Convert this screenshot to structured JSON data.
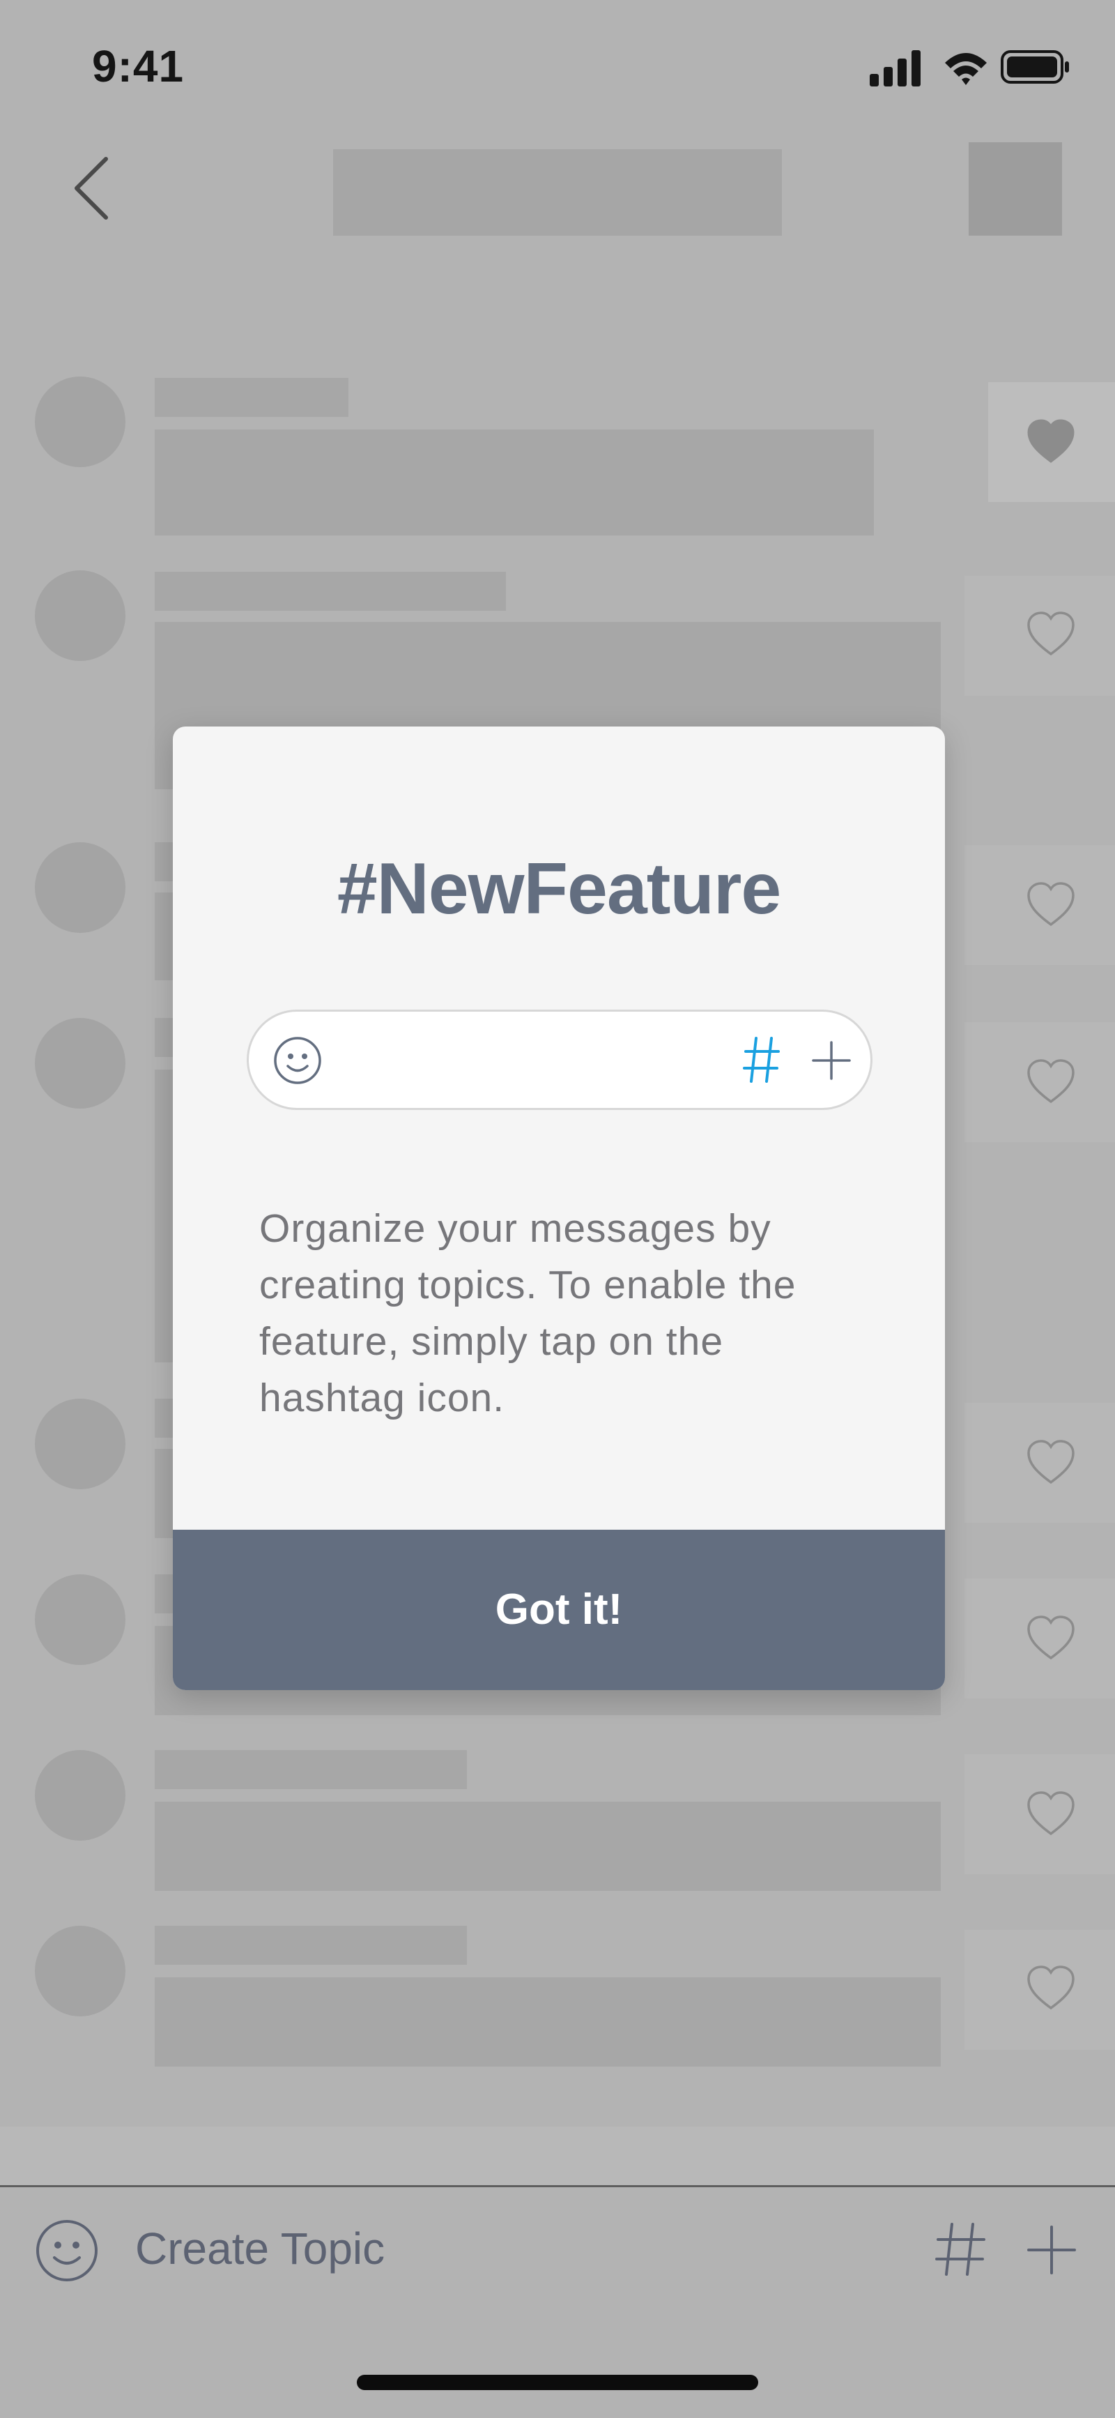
{
  "status_bar": {
    "time": "9:41"
  },
  "modal": {
    "title": "#NewFeature",
    "body": "Organize your messages by creating topics. To enable the feature, simply tap on the hashtag icon.",
    "button_label": "Got it!",
    "accent_color": "#636e80",
    "hash_color": "#1aa0e0"
  },
  "composer": {
    "placeholder": "Create Topic"
  },
  "icons": {
    "back": "chevron-left-icon",
    "emoji": "smiley-icon",
    "hashtag": "hashtag-icon",
    "add": "plus-icon",
    "like": "heart-icon"
  }
}
